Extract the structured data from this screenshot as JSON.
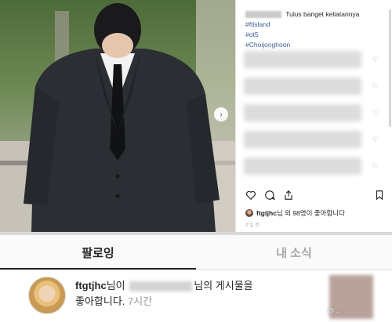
{
  "post": {
    "caption_text": "Tulus banget keliatannya",
    "hashtags": [
      "#ftisland",
      "#ot5",
      "#Choijonghoon"
    ],
    "action_icons": [
      "heart-icon",
      "comment-icon",
      "share-icon",
      "bookmark-icon"
    ],
    "likes": {
      "user": "ftgtjhc",
      "text_suffix": "님 외 98명이 좋아합니다"
    },
    "time": "2 일 전",
    "next_glyph": "›"
  },
  "activity": {
    "tabs": [
      {
        "label": "팔로잉",
        "active": true
      },
      {
        "label": "내 소식",
        "active": false
      }
    ],
    "item": {
      "username": "ftgtjhc",
      "text_1": "님이",
      "text_2": "님의 게시물을",
      "text_3": "좋아합니다.",
      "time": "7시간"
    }
  },
  "watermark": "@ ...",
  "colors": {
    "hashtag": "#3e5f94",
    "tab_inactive": "#a8a8a8",
    "time_gray": "#999999"
  }
}
